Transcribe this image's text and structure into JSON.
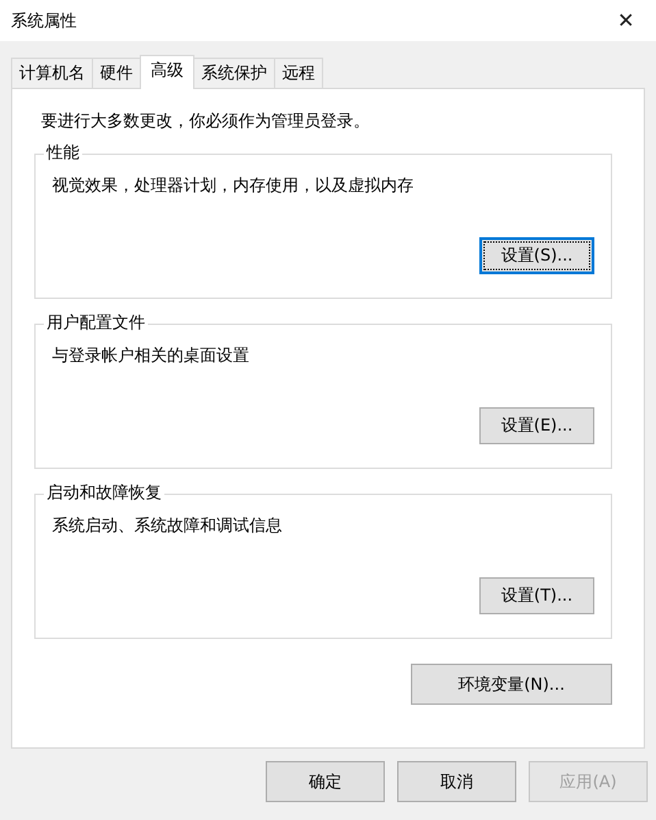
{
  "window": {
    "title": "系统属性",
    "close": "✕"
  },
  "tabs": [
    {
      "label": "计算机名",
      "selected": false
    },
    {
      "label": "硬件",
      "selected": false
    },
    {
      "label": "高级",
      "selected": true
    },
    {
      "label": "系统保护",
      "selected": false
    },
    {
      "label": "远程",
      "selected": false
    }
  ],
  "notice": "要进行大多数更改，你必须作为管理员登录。",
  "groups": [
    {
      "title": "性能",
      "description": "视觉效果，处理器计划，内存使用，以及虚拟内存",
      "button": {
        "label": "设置(S)...",
        "focused": true
      }
    },
    {
      "title": "用户配置文件",
      "description": "与登录帐户相关的桌面设置",
      "button": {
        "label": "设置(E)...",
        "focused": false
      }
    },
    {
      "title": "启动和故障恢复",
      "description": "系统启动、系统故障和调试信息",
      "button": {
        "label": "设置(T)...",
        "focused": false
      }
    }
  ],
  "env_button": {
    "label": "环境变量(N)..."
  },
  "footer_buttons": [
    {
      "label": "确定",
      "disabled": false
    },
    {
      "label": "取消",
      "disabled": false
    },
    {
      "label": "应用(A)",
      "disabled": true
    }
  ]
}
